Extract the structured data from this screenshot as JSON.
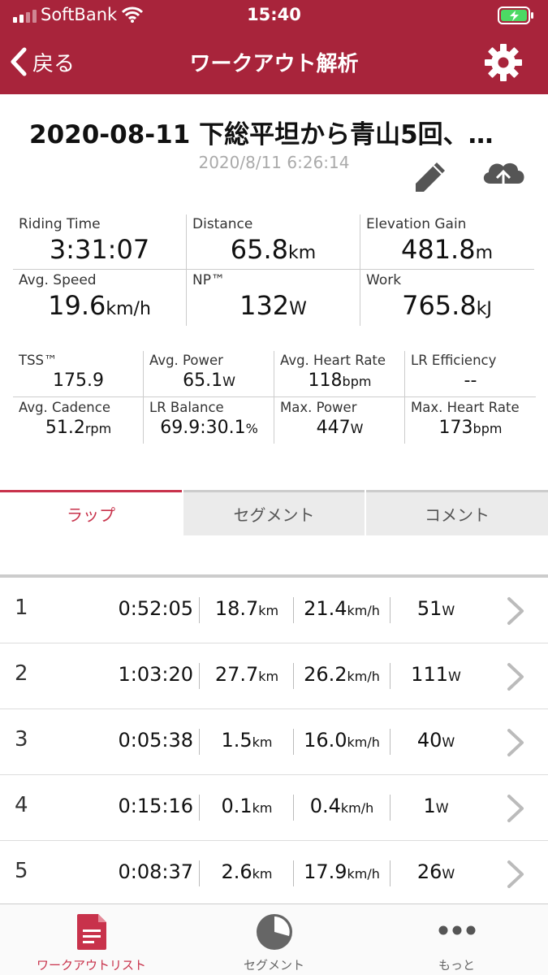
{
  "status_bar": {
    "carrier": "SoftBank",
    "time": "15:40"
  },
  "nav": {
    "back_label": "戻る",
    "title": "ワークアウト解析"
  },
  "workout": {
    "title": "2020-08-11 下総平坦から青山5回、…",
    "date": "2020/8/11 6:26:14"
  },
  "main_stats": [
    {
      "label": "Riding Time",
      "value": "3:31:07",
      "unit": ""
    },
    {
      "label": "Distance",
      "value": "65.8",
      "unit": "km"
    },
    {
      "label": "Elevation Gain",
      "value": "481.8",
      "unit": "m"
    },
    {
      "label": "Avg. Speed",
      "value": "19.6",
      "unit": "km/h"
    },
    {
      "label": "NP™",
      "value": "132",
      "unit": "W"
    },
    {
      "label": "Work",
      "value": "765.8",
      "unit": "kJ"
    }
  ],
  "detail_stats": [
    {
      "label": "TSS™",
      "value": "175.9",
      "unit": ""
    },
    {
      "label": "Avg. Power",
      "value": "65.1",
      "unit": "W"
    },
    {
      "label": "Avg. Heart Rate",
      "value": "118",
      "unit": "bpm"
    },
    {
      "label": "LR Efficiency",
      "value": "--",
      "unit": ""
    },
    {
      "label": "Avg. Cadence",
      "value": "51.2",
      "unit": "rpm"
    },
    {
      "label": "LR Balance",
      "value": "69.9:30.1",
      "unit": "%"
    },
    {
      "label": "Max. Power",
      "value": "447",
      "unit": "W"
    },
    {
      "label": "Max. Heart Rate",
      "value": "173",
      "unit": "bpm"
    }
  ],
  "tabs": [
    {
      "label": "ラップ",
      "active": true
    },
    {
      "label": "セグメント",
      "active": false
    },
    {
      "label": "コメント",
      "active": false
    }
  ],
  "laps": [
    {
      "num": "1",
      "time": "0:52:05",
      "distance": "18.7",
      "distance_unit": "km",
      "speed": "21.4",
      "speed_unit": "km/h",
      "power": "51",
      "power_unit": "W"
    },
    {
      "num": "2",
      "time": "1:03:20",
      "distance": "27.7",
      "distance_unit": "km",
      "speed": "26.2",
      "speed_unit": "km/h",
      "power": "111",
      "power_unit": "W"
    },
    {
      "num": "3",
      "time": "0:05:38",
      "distance": "1.5",
      "distance_unit": "km",
      "speed": "16.0",
      "speed_unit": "km/h",
      "power": "40",
      "power_unit": "W"
    },
    {
      "num": "4",
      "time": "0:15:16",
      "distance": "0.1",
      "distance_unit": "km",
      "speed": "0.4",
      "speed_unit": "km/h",
      "power": "1",
      "power_unit": "W"
    },
    {
      "num": "5",
      "time": "0:08:37",
      "distance": "2.6",
      "distance_unit": "km",
      "speed": "17.9",
      "speed_unit": "km/h",
      "power": "26",
      "power_unit": "W"
    }
  ],
  "bottom_nav": [
    {
      "label": "ワークアウトリスト",
      "icon": "document-list-icon",
      "active": true
    },
    {
      "label": "セグメント",
      "icon": "pie-chart-icon",
      "active": false
    },
    {
      "label": "もっと",
      "icon": "more-dots-icon",
      "active": false
    }
  ],
  "colors": {
    "brand": "#a8243b",
    "accent": "#c8324b",
    "battery": "#4cd964"
  }
}
